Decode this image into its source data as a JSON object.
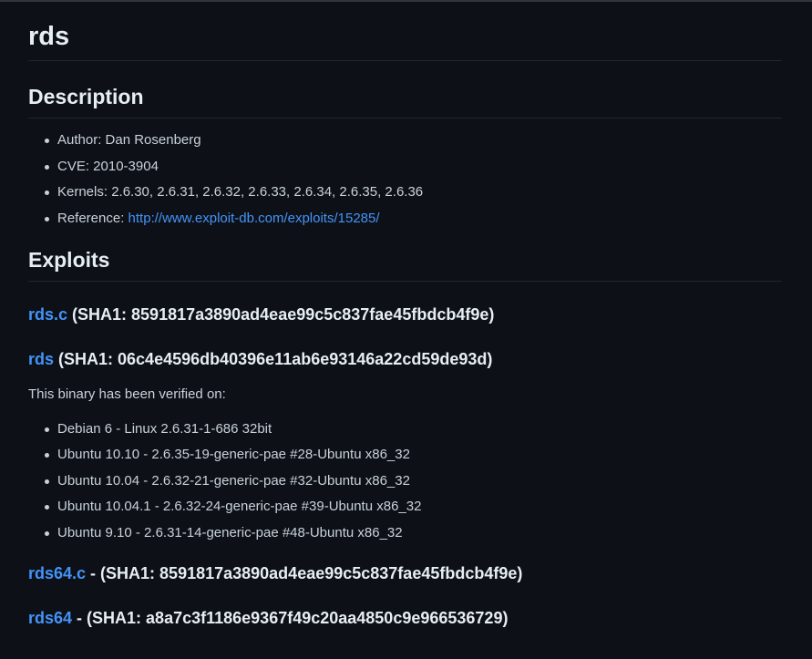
{
  "page": {
    "title": "rds"
  },
  "description": {
    "heading": "Description",
    "items": [
      {
        "label": "Author: Dan Rosenberg"
      },
      {
        "label": "CVE: 2010-3904"
      },
      {
        "label": "Kernels: 2.6.30, 2.6.31, 2.6.32, 2.6.33, 2.6.34, 2.6.35, 2.6.36"
      },
      {
        "label": "Reference: ",
        "link": "http://www.exploit-db.com/exploits/15285/"
      }
    ]
  },
  "exploits": {
    "heading": "Exploits",
    "entries": [
      {
        "name": "rds.c",
        "hash": " (SHA1: 8591817a3890ad4eae99c5c837fae45fbdcb4f9e)"
      },
      {
        "name": "rds",
        "hash": " (SHA1: 06c4e4596db40396e11ab6e93146a22cd59de93d)"
      },
      {
        "name": "rds64.c",
        "hash": " - (SHA1: 8591817a3890ad4eae99c5c837fae45fbdcb4f9e)"
      },
      {
        "name": "rds64",
        "hash": " - (SHA1: a8a7c3f1186e9367f49c20aa4850c9e966536729)"
      }
    ],
    "verified_text": "This binary has been verified on:",
    "verified_on": [
      "Debian 6 - Linux 2.6.31-1-686 32bit",
      "Ubuntu 10.10 - 2.6.35-19-generic-pae #28-Ubuntu x86_32",
      "Ubuntu 10.04 - 2.6.32-21-generic-pae #32-Ubuntu x86_32",
      "Ubuntu 10.04.1 - 2.6.32-24-generic-pae #39-Ubuntu x86_32",
      "Ubuntu 9.10 - 2.6.31-14-generic-pae #48-Ubuntu x86_32"
    ]
  }
}
